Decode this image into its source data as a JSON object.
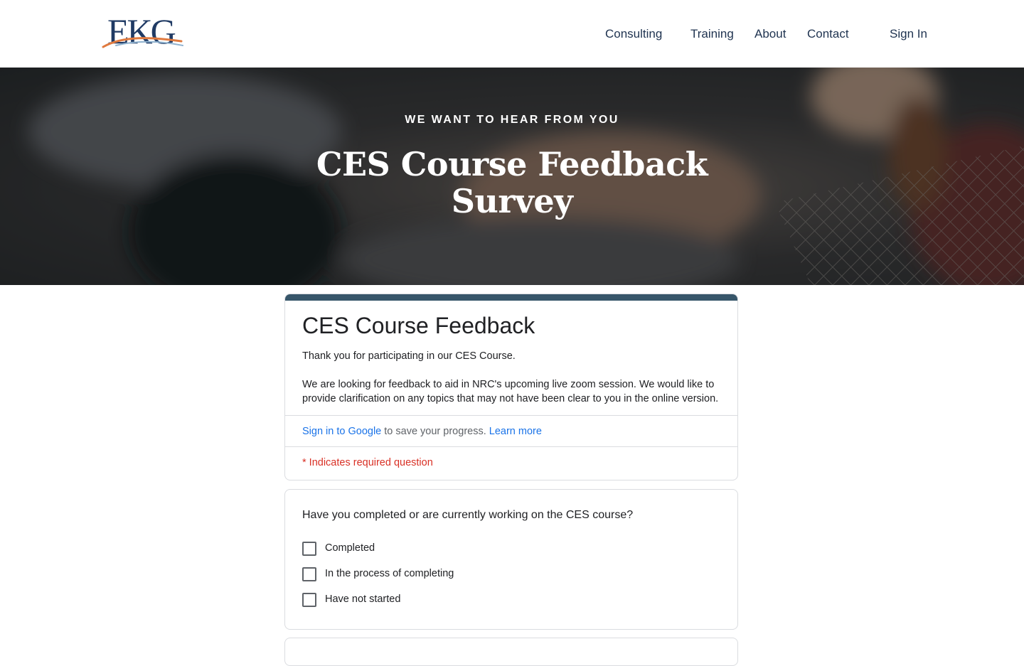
{
  "header": {
    "logo_text": "EKG",
    "nav": [
      "Consulting",
      "Training",
      "About",
      "Contact"
    ],
    "sign_in": "Sign In"
  },
  "hero": {
    "kicker": "WE WANT TO HEAR FROM YOU",
    "title": "CES Course Feedback Survey"
  },
  "form": {
    "title": "CES Course Feedback",
    "description": [
      "Thank you for participating in our CES Course.",
      "We are looking for feedback to aid in NRC's upcoming live zoom session. We would like to provide clarification on any topics that may not have been clear to you in the online version."
    ],
    "signin_link": "Sign in to Google",
    "signin_suffix": " to save your progress. ",
    "learn_more": "Learn more",
    "required_note": "* Indicates required question"
  },
  "question": {
    "text": "Have you completed or are currently working on the CES course?",
    "options": [
      "Completed",
      "In the process of completing",
      "Have not started"
    ]
  },
  "colors": {
    "form_accent": "#37566a",
    "nav_text": "#1f3350",
    "link_blue": "#1a73e8",
    "required_red": "#d93025",
    "logo_navy": "#1f3a64",
    "logo_orange": "#e07a3f"
  }
}
